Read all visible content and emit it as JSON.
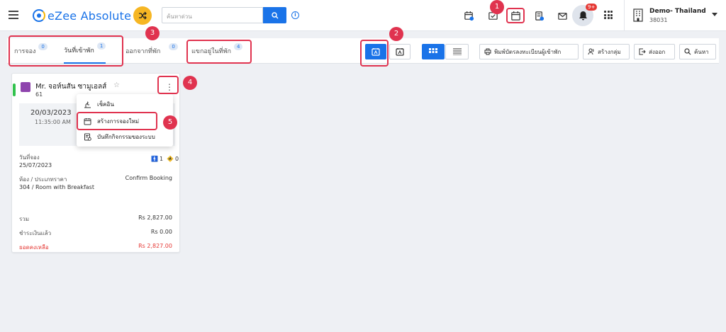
{
  "header": {
    "logo_text": "eZee Absolute",
    "search_placeholder": "ค้นหาด่วน",
    "notification_badge": "9+",
    "hotel_name": "Demo- Thailand",
    "hotel_code": "38031",
    "icons": [
      "menu-icon",
      "shuffle-icon",
      "search-icon",
      "info-icon",
      "calendar-add-icon",
      "checklist-icon",
      "calendar-icon",
      "report-icon",
      "mail-icon",
      "bell-icon",
      "apps-icon",
      "hotel-icon"
    ]
  },
  "tabs": [
    {
      "label": "การจอง",
      "count": "0"
    },
    {
      "label": "วันที่เข้าพัก",
      "count": "1"
    },
    {
      "label": "ออกจากที่พัก",
      "count": "0"
    },
    {
      "label": "แขกอยู่ในที่พัก",
      "count": "4"
    }
  ],
  "actions": {
    "print_label": "พิมพ์บัตรลงทะเบียนผู้เข้าพัก",
    "group_label": "สร้างกลุ่ม",
    "export_label": "ส่งออก",
    "search_label": "ค้นหา"
  },
  "card": {
    "guest_name": "Mr. จอห์นสัน ซามูเอลส์",
    "room_number": "61",
    "arrival_date": "20/03/2023",
    "arrival_time": "11:35:00 AM",
    "booking_date_label": "วันที่จอง",
    "booking_date": "25/07/2023",
    "adults": "1",
    "children": "0",
    "room_rate_label": "ห้อง / ประเภทราคา",
    "room_rate": "304 / Room with Breakfast",
    "status": "Confirm Booking",
    "total_label": "รวม",
    "total": "Rs 2,827.00",
    "paid_label": "ชำระเงินแล้ว",
    "paid": "Rs 0.00",
    "balance_label": "ยอดคงเหลือ",
    "balance": "Rs 2,827.00"
  },
  "menu": {
    "items": [
      {
        "label": "เช็คอิน",
        "icon": "checkin-icon"
      },
      {
        "label": "สร้างการจองใหม่",
        "icon": "calendar-icon"
      },
      {
        "label": "บันทึกกิจกรรมของระบบ",
        "icon": "log-icon"
      }
    ]
  },
  "annotations": [
    "1",
    "2",
    "3",
    "4",
    "5"
  ],
  "colors": {
    "accent": "#1a73e8",
    "highlight": "#e0334f",
    "balance": "#e53935",
    "status_bar": "#32c24d"
  }
}
